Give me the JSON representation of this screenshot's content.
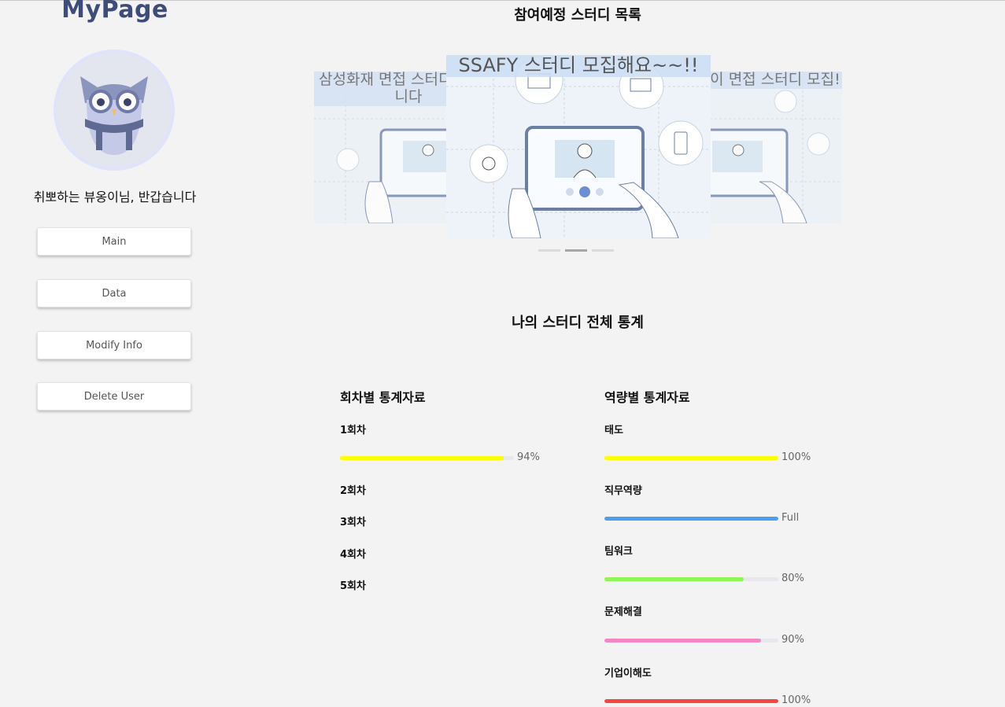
{
  "sidebar": {
    "logo": "MyPage",
    "greeting": "취뽀하는 뷰옹이님, 반갑습니다",
    "nav": [
      {
        "label": "Main"
      },
      {
        "label": "Data"
      },
      {
        "label": "Modify Info"
      },
      {
        "label": "Delete User"
      }
    ]
  },
  "upcoming": {
    "title": "참여예정 스터디 목록",
    "cards": [
      {
        "title": "삼성화재 면접 스터디 모집합니다"
      },
      {
        "title": "SSAFY 스터디 모집해요~~!!"
      },
      {
        "title": "카카오페이 면접 스터디 모집!"
      }
    ],
    "active_slide": 2,
    "slide_count": 3
  },
  "stats": {
    "title": "나의 스터디 전체 통계",
    "session": {
      "heading": "회차별 통계자료",
      "items": [
        {
          "label": "1회차",
          "value": "94%",
          "fraction": 0.94,
          "color": "#ffff00"
        },
        {
          "label": "2회차"
        },
        {
          "label": "3회차"
        },
        {
          "label": "4회차"
        },
        {
          "label": "5회차"
        }
      ]
    },
    "competency": {
      "heading": "역량별 통계자료",
      "items": [
        {
          "label": "태도",
          "value": "100%",
          "fraction": 1.0,
          "color": "#ffff00"
        },
        {
          "label": "직무역량",
          "value": "Full",
          "fraction": 1.0,
          "color": "#4a9ff0"
        },
        {
          "label": "팀워크",
          "value": "80%",
          "fraction": 0.8,
          "color": "#8ef55c"
        },
        {
          "label": "문제해결",
          "value": "90%",
          "fraction": 0.9,
          "color": "#f088c8"
        },
        {
          "label": "기업이해도",
          "value": "100%",
          "fraction": 1.0,
          "color": "#f04848"
        }
      ]
    }
  }
}
